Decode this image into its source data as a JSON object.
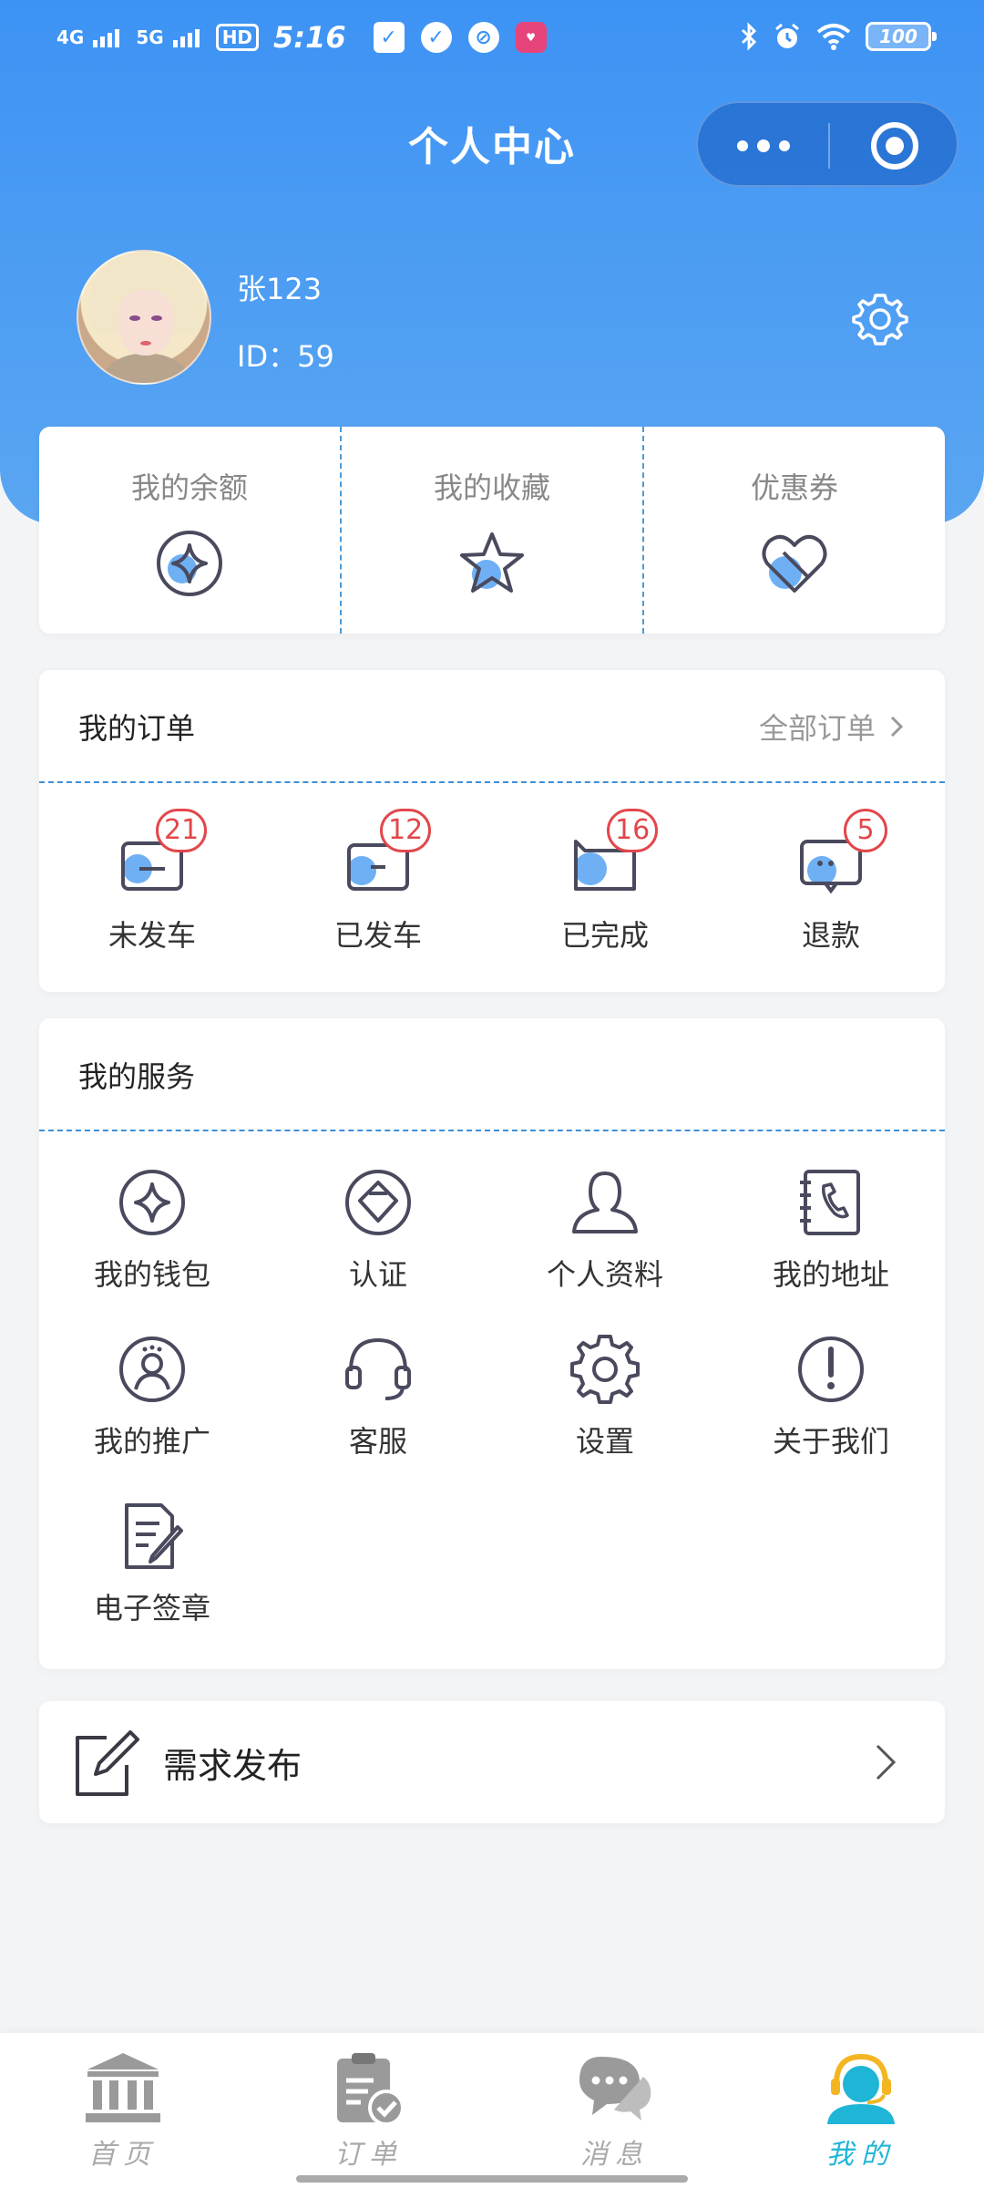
{
  "status_bar": {
    "network1": "4G",
    "network2": "5G",
    "hd": "HD",
    "time": "5:16",
    "battery": "100"
  },
  "header": {
    "title": "个人中心"
  },
  "profile": {
    "name": "张123",
    "id_text": "ID：59"
  },
  "quick_links": [
    {
      "label": "我的余额",
      "icon": "wallet-diamond-icon"
    },
    {
      "label": "我的收藏",
      "icon": "star-icon"
    },
    {
      "label": "优惠券",
      "icon": "heart-coupon-icon"
    }
  ],
  "orders": {
    "title": "我的订单",
    "all_label": "全部订单",
    "items": [
      {
        "label": "未发车",
        "badge": "21",
        "icon": "pending-order-icon"
      },
      {
        "label": "已发车",
        "badge": "12",
        "icon": "shipped-order-icon"
      },
      {
        "label": "已完成",
        "badge": "16",
        "icon": "completed-order-icon"
      },
      {
        "label": "退款",
        "badge": "5",
        "icon": "refund-icon"
      }
    ]
  },
  "services": {
    "title": "我的服务",
    "items": [
      {
        "label": "我的钱包",
        "icon": "wallet-icon"
      },
      {
        "label": "认证",
        "icon": "certify-icon"
      },
      {
        "label": "个人资料",
        "icon": "user-profile-icon"
      },
      {
        "label": "我的地址",
        "icon": "address-book-icon"
      },
      {
        "label": "我的推广",
        "icon": "promotion-icon"
      },
      {
        "label": "客服",
        "icon": "headset-icon"
      },
      {
        "label": "设置",
        "icon": "gear-icon"
      },
      {
        "label": "关于我们",
        "icon": "info-icon"
      },
      {
        "label": "电子签章",
        "icon": "e-signature-icon"
      }
    ]
  },
  "publish": {
    "label": "需求发布"
  },
  "tabbar": [
    {
      "label": "首页",
      "icon": "bank-icon",
      "active": false
    },
    {
      "label": "订单",
      "icon": "clipboard-check-icon",
      "active": false
    },
    {
      "label": "消息",
      "icon": "chat-bubble-icon",
      "active": false
    },
    {
      "label": "我的",
      "icon": "profile-headset-icon",
      "active": true
    }
  ],
  "colors": {
    "primary": "#3d93f4",
    "badge": "#e2474b",
    "active_tab": "#1fb5d6",
    "icon_stroke": "#4a4a5e",
    "icon_accent": "#6fb0f5"
  }
}
